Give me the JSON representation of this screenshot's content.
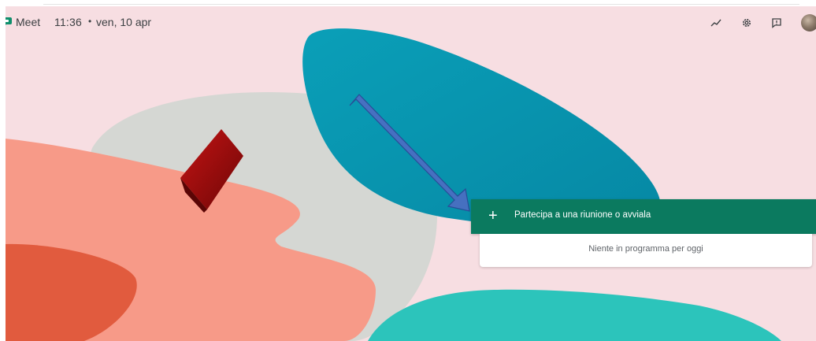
{
  "header": {
    "app_name": "Meet",
    "time": "11:36",
    "separator": "•",
    "date": "ven, 10 apr",
    "icons": [
      "trend-icon",
      "gear-icon",
      "feedback-icon",
      "avatar"
    ]
  },
  "main": {
    "join_button": {
      "icon": "plus-icon",
      "label": "Partecipa a una riunione o avviala"
    },
    "schedule_message": "Niente in programma per oggi"
  },
  "colors": {
    "background": "#f7dee2",
    "primary_button": "#0b7a5f",
    "annotation_arrow": "#4a6fc2",
    "text": "#3c4043"
  }
}
